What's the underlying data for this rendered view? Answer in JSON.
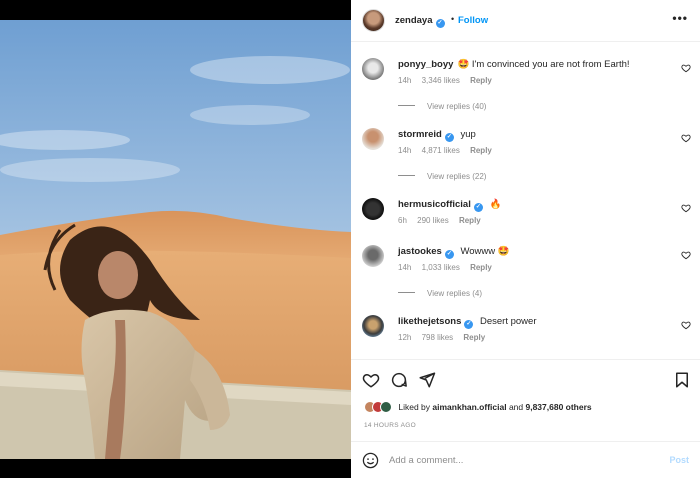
{
  "colors": {
    "accent": "#0095f6",
    "verified": "#3897f0",
    "muted": "#8e8e8e",
    "text": "#262626"
  },
  "post": {
    "author": "zendaya",
    "dot": "•",
    "follow_label": "Follow",
    "more_icon": "more-horizontal-icon",
    "image_description_icon": "photo"
  },
  "comments": [
    {
      "user": "ponyy_boyy",
      "verified": false,
      "emoji": "🤩",
      "text": " I'm convinced you are not from Earth!",
      "time": "14h",
      "likes": "3,346 likes",
      "reply": "Reply",
      "view_replies": "View replies (40)"
    },
    {
      "user": "stormreid",
      "verified": true,
      "emoji": "",
      "text": "yup",
      "time": "14h",
      "likes": "4,871 likes",
      "reply": "Reply",
      "view_replies": "View replies (22)"
    },
    {
      "user": "hermusicofficial",
      "verified": true,
      "emoji": "🔥",
      "text": "",
      "time": "6h",
      "likes": "290 likes",
      "reply": "Reply",
      "view_replies": ""
    },
    {
      "user": "jastookes",
      "verified": true,
      "emoji": "🤩",
      "text": "Wowww ",
      "time": "14h",
      "likes": "1,033 likes",
      "reply": "Reply",
      "view_replies": "View replies (4)"
    },
    {
      "user": "likethejetsons",
      "verified": true,
      "emoji": "",
      "text": "Desert power",
      "time": "12h",
      "likes": "798 likes",
      "reply": "Reply",
      "view_replies": ""
    }
  ],
  "actions": {
    "liked_by_prefix": "Liked by ",
    "liked_by_user": "aimankhan.official",
    "liked_by_and": " and ",
    "liked_by_count": "9,837,680 others",
    "time_ago": "14 HOURS AGO"
  },
  "add_comment": {
    "placeholder": "Add a comment...",
    "post_label": "Post"
  },
  "verified_mark": "✓"
}
